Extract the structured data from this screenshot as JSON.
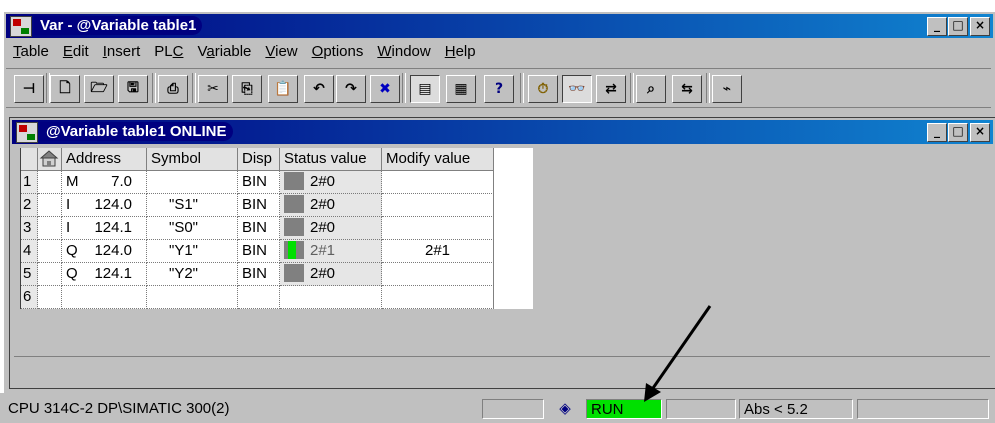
{
  "window": {
    "title": "Var - @Variable table1",
    "controls": {
      "minimize": "_",
      "maximize": "□",
      "close": "×"
    }
  },
  "menu": {
    "items": [
      {
        "accel": "T",
        "rest": "able"
      },
      {
        "accel": "E",
        "rest": "dit"
      },
      {
        "accel": "I",
        "rest": "nsert"
      },
      {
        "pre": "PL",
        "accel": "C",
        "rest": ""
      },
      {
        "pre": "V",
        "accel": "a",
        "rest": "riable"
      },
      {
        "accel": "V",
        "rest": "iew"
      },
      {
        "accel": "O",
        "rest": "ptions"
      },
      {
        "accel": "W",
        "rest": "indow"
      },
      {
        "accel": "H",
        "rest": "elp"
      }
    ]
  },
  "toolbar": {
    "icons": [
      "pin-icon",
      "new-icon",
      "open-icon",
      "save-icon",
      "print-icon",
      "cut-icon",
      "copy-icon",
      "paste-icon",
      "undo-icon",
      "redo-icon",
      "delete-icon",
      "online-icon",
      "accessible-nodes-icon",
      "whats-this-icon",
      "monitor-icon",
      "glasses-icon",
      "modify-icon",
      "monitor-once-icon",
      "modify-once-icon",
      "trigger-icon"
    ],
    "glyphs": [
      "⊣",
      "🗋",
      "🗁",
      "🖫",
      "⎙",
      "✂",
      "⎘",
      "📋",
      "↶",
      "↷",
      "✖",
      "▤",
      "▦",
      "?",
      "⏱",
      "👓",
      "⇄",
      "⌕",
      "⇆",
      "⌁"
    ]
  },
  "table_window": {
    "title": "@Variable table1  ONLINE",
    "columns": [
      "",
      "",
      "Address",
      "Symbol",
      "Disp",
      "Status value",
      "Modify value"
    ],
    "rows": [
      {
        "num": "1",
        "op": "M",
        "addr": "7.0",
        "symbol": "",
        "disp": "BIN",
        "status": "2#0",
        "status_on": false,
        "status_dim": false,
        "modify": ""
      },
      {
        "num": "2",
        "op": "I",
        "addr": "124.0",
        "symbol": "\"S1\"",
        "disp": "BIN",
        "status": "2#0",
        "status_on": false,
        "status_dim": false,
        "modify": ""
      },
      {
        "num": "3",
        "op": "I",
        "addr": "124.1",
        "symbol": "\"S0\"",
        "disp": "BIN",
        "status": "2#0",
        "status_on": false,
        "status_dim": false,
        "modify": ""
      },
      {
        "num": "4",
        "op": "Q",
        "addr": "124.0",
        "symbol": "\"Y1\"",
        "disp": "BIN",
        "status": "2#1",
        "status_on": true,
        "status_dim": true,
        "modify": "2#1"
      },
      {
        "num": "5",
        "op": "Q",
        "addr": "124.1",
        "symbol": "\"Y2\"",
        "disp": "BIN",
        "status": "2#0",
        "status_on": false,
        "status_dim": false,
        "modify": ""
      },
      {
        "num": "6",
        "op": "",
        "addr": "",
        "symbol": "",
        "disp": "",
        "status": "",
        "status_on": false,
        "status_dim": false,
        "modify": ""
      }
    ]
  },
  "statusbar": {
    "connection": "CPU 314C-2 DP\\SIMATIC 300(2)",
    "empty": "",
    "mode_icon": "◈",
    "mode": "RUN",
    "mode_color": "#00e000",
    "address_mode": "Abs < 5.2",
    "extra": ""
  },
  "colors": {
    "title_active": "#000080",
    "run": "#00e000",
    "face": "#c0c0c0"
  }
}
